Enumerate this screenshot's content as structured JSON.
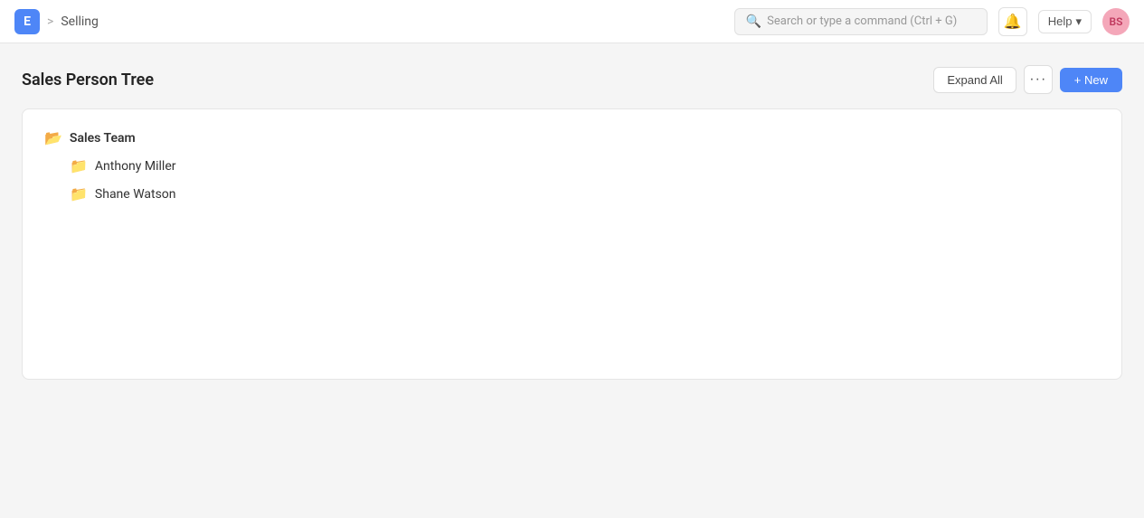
{
  "header": {
    "app_icon_label": "E",
    "breadcrumb_sep": ">",
    "breadcrumb_current": "Selling",
    "search_placeholder": "Search or type a command (Ctrl + G)",
    "help_label": "Help",
    "help_chevron": "▾",
    "avatar_initials": "BS",
    "notification_icon": "🔔"
  },
  "page": {
    "title": "Sales Person Tree",
    "expand_all_label": "Expand All",
    "more_label": "···",
    "new_label": "+ New"
  },
  "tree": {
    "root": {
      "label": "Sales Team",
      "children": [
        {
          "label": "Anthony Miller"
        },
        {
          "label": "Shane Watson"
        }
      ]
    }
  }
}
